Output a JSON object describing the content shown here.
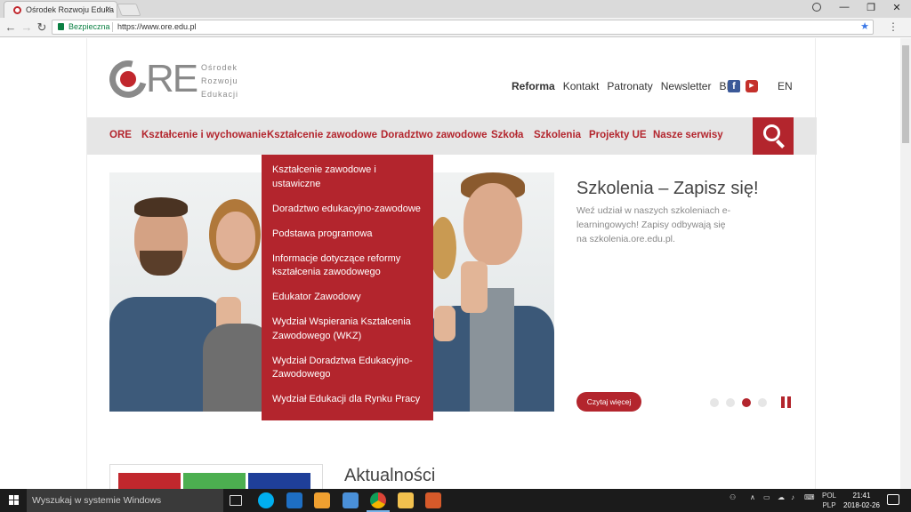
{
  "browser": {
    "tab_title": "Ośrodek Rozwoju Eduka",
    "tab_close": "×",
    "secure_label": "Bezpieczna",
    "url": "https://www.ore.edu.pl",
    "star": "★",
    "menu": "⋮",
    "back": "←",
    "forward": "→",
    "reload": "↻",
    "minimize": "—",
    "restore": "❐",
    "close": "✕"
  },
  "site": {
    "logo": {
      "mark": "RE",
      "line1": "Ośrodek",
      "line2": "Rozwoju",
      "line3": "Edukacji"
    },
    "top_links": [
      "Reforma",
      "Kontakt",
      "Patronaty",
      "Newsletter",
      "BIP"
    ],
    "facebook_glyph": "f",
    "youtube_glyph": "▶",
    "lang": "EN",
    "nav": [
      "ORE",
      "Kształcenie i wychowanie",
      "Kształcenie zawodowe",
      "Doradztwo zawodowe",
      "Szkoła",
      "Szkolenia",
      "Projekty UE",
      "Nasze serwisy"
    ],
    "dropdown": [
      "Kształcenie zawodowe i ustawiczne",
      "Doradztwo edukacyjno-zawodowe",
      "Podstawa programowa",
      "Informacje dotyczące reformy kształcenia zawodowego",
      "Edukator Zawodowy",
      "Wydział Wspierania Kształcenia Zawodowego (WKZ)",
      "Wydział Doradztwa Edukacyjno-Zawodowego",
      "Wydział Edukacji dla Rynku Pracy"
    ],
    "hero": {
      "title": "Szkolenia – Zapisz się!",
      "description": "Weź udział w naszych szkoleniach e-learningowych! Zapisy odbywają się na szkolenia.ore.edu.pl.",
      "button": "Czytaj więcej",
      "slide_active": 3,
      "slide_count": 4
    },
    "news_title": "Aktualności"
  },
  "taskbar": {
    "search_placeholder": "Wyszukaj w systemie Windows",
    "lang1": "POL",
    "lang2": "PLP",
    "time": "21:41",
    "date": "2018-02-26"
  },
  "colors": {
    "brand_red": "#b3252d",
    "logo_grey": "#8a8a8a",
    "nav_bg": "#e6e6e6"
  }
}
